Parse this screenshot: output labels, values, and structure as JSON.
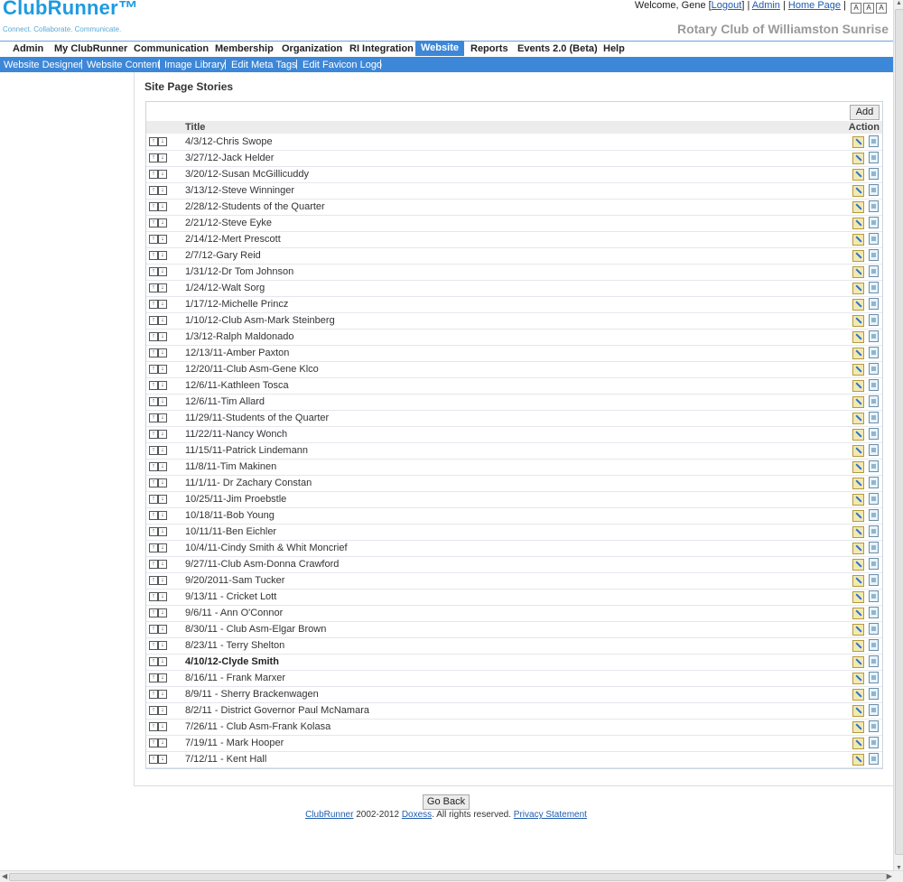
{
  "header": {
    "logo": "ClubRunner™",
    "tagline": "Connect. Collaborate. Communicate.",
    "welcome_prefix": "Welcome, Gene [",
    "logout": "Logout",
    "welcome_suffix": "] | ",
    "admin_link": "Admin",
    "sep": " | ",
    "home_link": "Home Page",
    "sep2": " |",
    "font_buttons": [
      "A",
      "A",
      "A"
    ],
    "club_name": "Rotary Club of Williamston Sunrise"
  },
  "nav": {
    "items": [
      "Admin",
      "My ClubRunner",
      "Communication",
      "Membership",
      "Organization",
      "RI Integration",
      "Website",
      "Reports",
      "Events 2.0 (Beta)",
      "Help"
    ],
    "active": "Website"
  },
  "subnav": {
    "items": [
      "Website Designer",
      "Website Content",
      "Image Library",
      "Edit Meta Tags",
      "Edit Favicon Logo"
    ],
    "sep": "|"
  },
  "page": {
    "title": "Site Page Stories",
    "add_label": "Add",
    "col_title": "Title",
    "col_action": "Action",
    "go_back": "Go Back"
  },
  "arrows": {
    "up": "↑",
    "down": "↓"
  },
  "rows": [
    "4/3/12-Chris Swope",
    "3/27/12-Jack Helder",
    "3/20/12-Susan McGillicuddy",
    "3/13/12-Steve Winninger",
    "2/28/12-Students of the Quarter",
    "2/21/12-Steve Eyke",
    "2/14/12-Mert Prescott",
    "2/7/12-Gary Reid",
    "1/31/12-Dr Tom Johnson",
    "1/24/12-Walt Sorg",
    "1/17/12-Michelle Princz",
    "1/10/12-Club Asm-Mark Steinberg",
    "1/3/12-Ralph Maldonado",
    "12/13/11-Amber Paxton",
    "12/20/11-Club Asm-Gene Klco",
    "12/6/11-Kathleen Tosca",
    "12/6/11-Tim Allard",
    "11/29/11-Students of the Quarter",
    "11/22/11-Nancy Wonch",
    "11/15/11-Patrick Lindemann",
    "11/8/11-Tim Makinen",
    "11/1/11- Dr Zachary Constan",
    "10/25/11-Jim Proebstle",
    "10/18/11-Bob Young",
    "10/11/11-Ben Eichler",
    "10/4/11-Cindy Smith & Whit Moncrief",
    "9/27/11-Club Asm-Donna Crawford",
    "9/20/2011-Sam Tucker",
    "9/13/11 - Cricket Lott",
    "9/6/11 - Ann O'Connor",
    "8/30/11 - Club Asm-Elgar Brown",
    "8/23/11 - Terry Shelton",
    "4/10/12-Clyde Smith",
    "8/16/11 - Frank Marxer",
    "8/9/11 - Sherry Brackenwagen",
    "8/2/11 - District Governor Paul McNamara",
    "7/26/11 - Club Asm-Frank Kolasa",
    "7/19/11 - Mark Hooper",
    "7/12/11 - Kent Hall"
  ],
  "bold_row": "4/10/12-Clyde Smith",
  "footer": {
    "brand": "ClubRunner",
    "years": " 2002-2012 ",
    "company": "Doxess",
    "rights": ". All rights reserved. ",
    "privacy": "Privacy Statement"
  },
  "scrollbar": {
    "up": "▲",
    "down": "▼",
    "left": "◀",
    "right": "▶"
  },
  "colors": {
    "accent": "#3d87d8",
    "logo": "#1e9be0",
    "link": "#1e5bb0"
  }
}
